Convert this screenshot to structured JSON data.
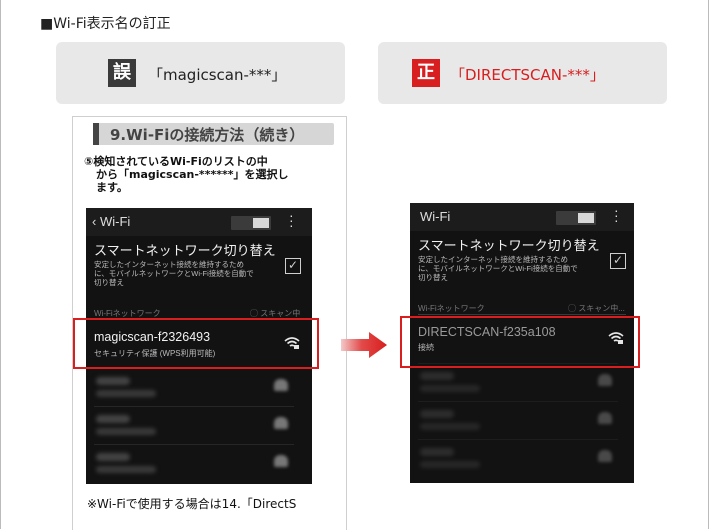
{
  "header": {
    "title": "■Wi-Fi表示名の訂正"
  },
  "wrong_box": {
    "badge": "誤",
    "text": "「magicscan-***」"
  },
  "correct_box": {
    "badge": "正",
    "text": "「DIRECTSCAN-***」"
  },
  "card": {
    "heading": "9.Wi-Fiの接続方法（続き）",
    "step_line1": "⑤検知されているWi-Fiのリストの中",
    "step_line2": "から「magicscan-******」を選択し",
    "step_line3": "ます。",
    "note": "※Wi-Fiで使用する場合は14.「DirectS"
  },
  "phone_left": {
    "back_glyph": "‹",
    "title": "Wi-Fi",
    "smart_network_title": "スマートネットワーク切り替え",
    "smart_network_desc": "安定したインターネット接続を維持するために、モバイルネットワークとWi-Fi接続を自動で切り替え",
    "check": "✓",
    "section_label": "Wi-Fiネットワーク",
    "scanning": "◯ スキャン中",
    "network_name": "magicscan-f2326493",
    "network_sub": "セキュリティ保護 (WPS利用可能)",
    "signal_icon": "wifi-lock-icon"
  },
  "phone_right": {
    "title": "Wi-Fi",
    "smart_network_title": "スマートネットワーク切り替え",
    "smart_network_desc": "安定したインターネット接続を維持するために、モバイルネットワークとWi-Fi接続を自動で切り替え",
    "check": "✓",
    "section_label": "Wi-Fiネットワーク",
    "scanning": "◯ スキャン中...",
    "network_name": "DIRECTSCAN-f235a108",
    "network_sub": "接続",
    "signal_icon": "wifi-lock-icon"
  },
  "colors": {
    "accent_red": "#d81e1e",
    "dark_badge": "#3a3a3a",
    "box_bg": "#e8e8e8"
  }
}
